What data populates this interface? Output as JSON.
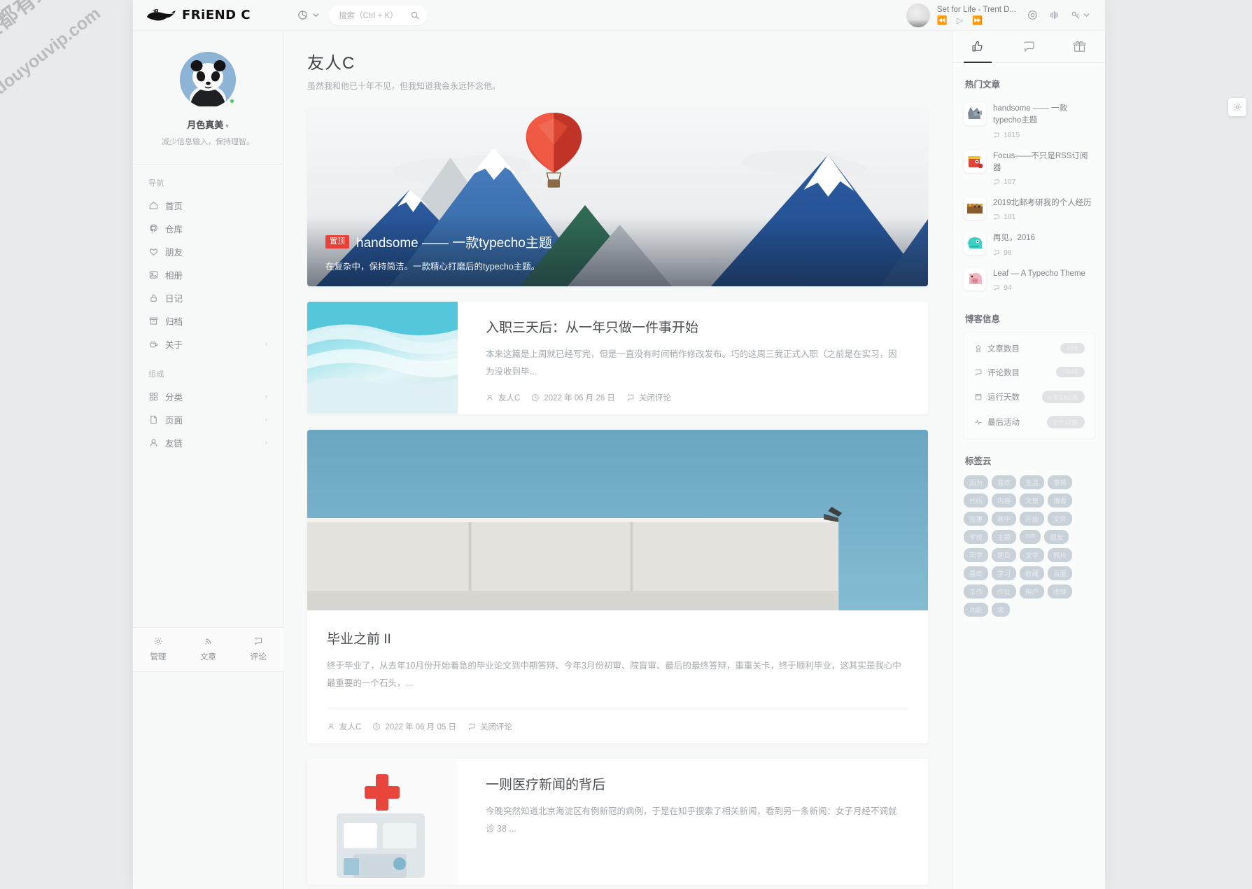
{
  "watermark": {
    "line1": "全都有综合资源网",
    "line2": "douyouvip.com"
  },
  "topbar": {
    "brand": "FRiEND C",
    "brand_icon": "whale-icon",
    "pie_icon": "pie-chart-icon",
    "chevron_icon": "chevron-down-icon",
    "search": {
      "placeholder": "搜索（Ctrl + K）",
      "icon": "search-icon"
    },
    "player": {
      "title": "Set for Life - Trent D...",
      "prev": "⏪",
      "play": "▷",
      "next": "⏩"
    },
    "icons": [
      {
        "name": "target-icon"
      },
      {
        "name": "broadcast-icon"
      },
      {
        "name": "link-icon"
      }
    ],
    "icon_chevron": "chevron-down-icon"
  },
  "sidebar": {
    "profile": {
      "name": "月色真美",
      "caret": "▾",
      "desc": "减少信息输入，保持理智。",
      "avatar": "panda-avatar",
      "status": "online"
    },
    "groups": [
      {
        "title": "导航",
        "items": [
          {
            "label": "首页",
            "icon": "home-icon",
            "arrow": false
          },
          {
            "label": "仓库",
            "icon": "github-icon",
            "arrow": false
          },
          {
            "label": "朋友",
            "icon": "heart-icon",
            "arrow": false
          },
          {
            "label": "相册",
            "icon": "image-icon",
            "arrow": false
          },
          {
            "label": "日记",
            "icon": "lock-icon",
            "arrow": false
          },
          {
            "label": "归档",
            "icon": "archive-icon",
            "arrow": false
          },
          {
            "label": "关于",
            "icon": "coffee-icon",
            "arrow": true
          }
        ]
      },
      {
        "title": "组成",
        "items": [
          {
            "label": "分类",
            "icon": "grid-icon",
            "arrow": true
          },
          {
            "label": "页面",
            "icon": "file-icon",
            "arrow": true
          },
          {
            "label": "友链",
            "icon": "user-icon",
            "arrow": true
          }
        ]
      }
    ],
    "footer": [
      {
        "label": "管理",
        "icon": "gear-icon"
      },
      {
        "label": "文章",
        "icon": "rss-icon"
      },
      {
        "label": "评论",
        "icon": "comment-icon"
      }
    ]
  },
  "main": {
    "title": "友人C",
    "subtitle": "虽然我和他已十年不见，但我知道我会永远怀念他。",
    "hero": {
      "badge": "置顶",
      "title": "handsome —— 一款typecho主题",
      "desc": "在复杂中，保持简洁。一款精心打磨后的typecho主题。"
    },
    "posts": [
      {
        "layout": "horizontal",
        "title": "入职三天后：从一年只做一件事开始",
        "excerpt": "本来这篇是上周就已经写完，但是一直没有时间稍作修改发布。巧的这周三我正式入职（之前是在实习，因为没收到毕...",
        "author": "友人C",
        "date": "2022 年 06 月 26 日",
        "comments": "关闭评论",
        "thumb": "beach-photo"
      },
      {
        "layout": "vertical",
        "title": "毕业之前 II",
        "excerpt": "终于毕业了，从去年10月份开始着急的毕业论文到中期答辩、今年3月份初审、院盲审、最后的最终答辩，重重关卡，终于顺利毕业，这其实是我心中最重要的一个石头，...",
        "author": "友人C",
        "date": "2022 年 06 月 05 日",
        "comments": "关闭评论",
        "cover": "blue-wall-photo"
      },
      {
        "layout": "horizontal",
        "title": "一则医疗新闻的背后",
        "excerpt": "今晚突然知道北京海淀区有例新冠的病例，于是在知乎搜索了相关新闻，看到另一条新闻：女子月经不调就诊 38 ...",
        "author": "",
        "date": "",
        "comments": "",
        "thumb": "medical-illustration"
      }
    ]
  },
  "right": {
    "tabs": [
      {
        "icon": "thumbs-up-icon",
        "active": true
      },
      {
        "icon": "comment-icon",
        "active": false
      },
      {
        "icon": "gift-icon",
        "active": false
      }
    ],
    "hot_title": "热门文章",
    "hot_items": [
      {
        "title": "handsome —— 一款typecho主题",
        "count": "1815",
        "icon": "cat-avatar"
      },
      {
        "title": "Focus——不只是RSS订阅器",
        "count": "107",
        "icon": "red-bag-avatar"
      },
      {
        "title": "2019北邮考研我的个人经历",
        "count": "101",
        "icon": "tiger-avatar"
      },
      {
        "title": "再见，2016",
        "count": "96",
        "icon": "dino-avatar"
      },
      {
        "title": "Leaf — A Typecho Theme",
        "count": "94",
        "icon": "pig-avatar"
      }
    ],
    "info_title": "博客信息",
    "info_rows": [
      {
        "label": "文章数目",
        "icon": "medal-icon",
        "value": "255"
      },
      {
        "label": "评论数目",
        "icon": "comment-icon",
        "value": "7845"
      },
      {
        "label": "运行天数",
        "icon": "calendar-icon",
        "value": "6年180天"
      },
      {
        "label": "最后活动",
        "icon": "activity-icon",
        "value": "2个月前"
      }
    ],
    "tag_title": "标签云",
    "tags": [
      "因为",
      "喜欢",
      "生活",
      "事情",
      "代码",
      "内容",
      "文章",
      "博客",
      "效果",
      "高中",
      "开始",
      "文件",
      "学校",
      "主题",
      "css",
      "朋友",
      "同学",
      "题目",
      "文字",
      "照片",
      "喜欢",
      "学习",
      "收藏",
      "百度",
      "工作",
      "作业",
      "用户",
      "地球",
      "功能",
      "求"
    ],
    "float_gear": "gear-icon"
  }
}
